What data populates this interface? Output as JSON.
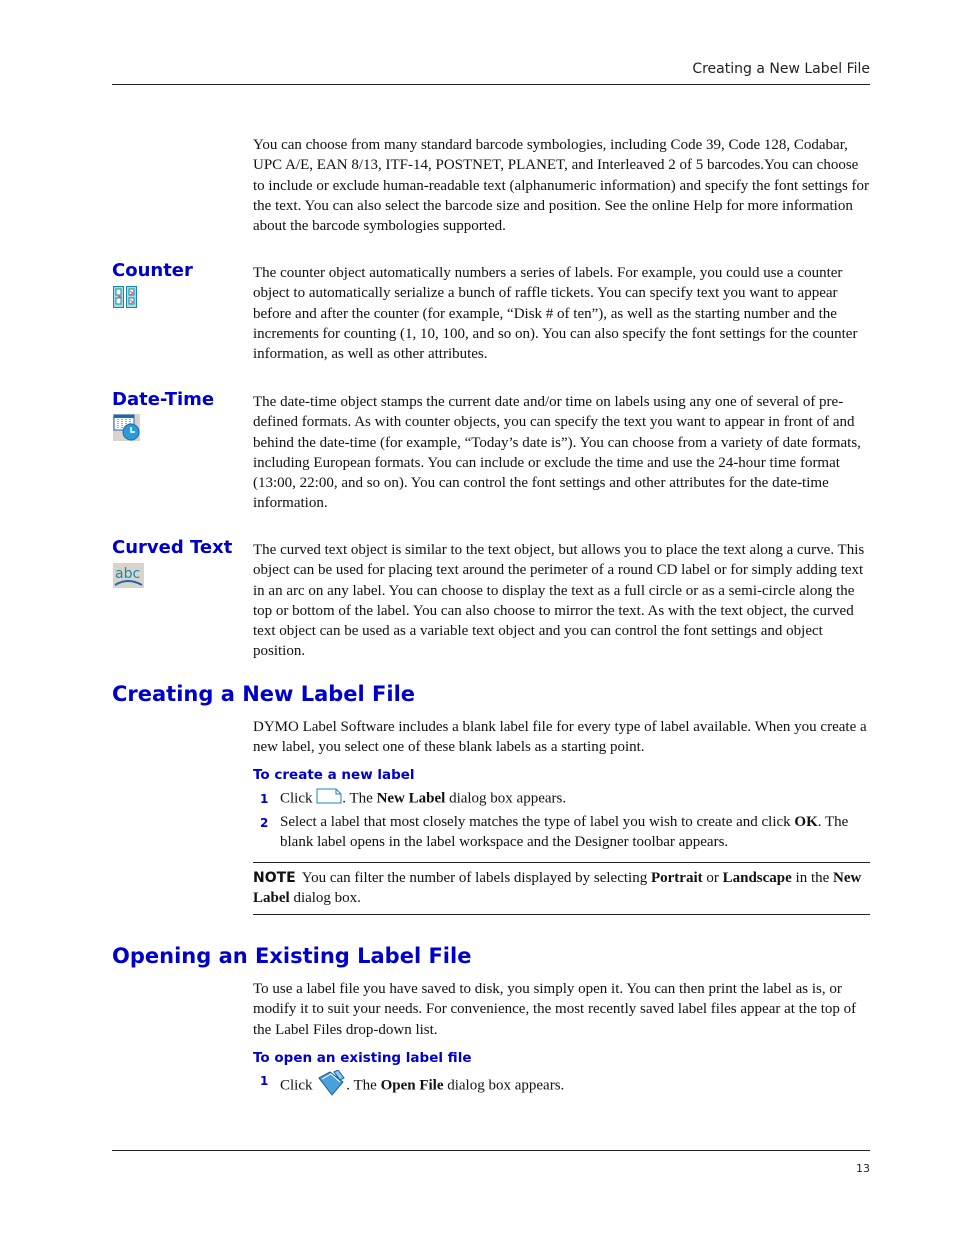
{
  "header": {
    "title": "Creating a New Label File"
  },
  "footer": {
    "page_number": "13"
  },
  "intro_paragraph": "You can choose from many standard barcode symbologies, including Code 39, Code 128, Codabar, UPC A/E, EAN 8/13, ITF-14, POSTNET, PLANET, and Interleaved 2 of 5 barcodes.You can choose to include or exclude human-readable text (alphanumeric information) and specify the font settings for the text. You can also select the barcode size and position. See the online Help for more information about the barcode symbologies supported.",
  "objects": [
    {
      "title": "Counter",
      "icon": "counter-icon",
      "text": "The counter object automatically numbers a series of labels. For example, you could use a counter object to automatically serialize a bunch of raffle tickets. You can specify text you want to appear before and after the counter (for example, “Disk # of ten”), as well as the starting number and the increments for counting (1, 10, 100, and so on). You can also specify the font settings for the counter information, as well as other attributes."
    },
    {
      "title": "Date-Time",
      "icon": "date-time-icon",
      "text": "The date-time object stamps the current date and/or time on labels using any one of several of pre-defined formats. As with counter objects, you can specify the text you want to appear in front of and behind the date-time (for example, “Today’s date is”). You can choose from a variety of date formats, including European formats. You can include or exclude the time and use the 24-hour time format (13:00, 22:00, and so on). You can control the font settings and other attributes for the date-time information."
    },
    {
      "title": "Curved Text",
      "icon": "curved-text-icon",
      "text": "The curved text object is similar to the text object, but allows you to place the text along a curve. This object can be used for placing text around the perimeter of a round CD label or for simply adding text in an arc on any label. You can choose to display the text as a full circle or as a semi-circle along the top or bottom of the label. You can also choose to mirror the text. As with the text object, the curved text object can be used as a variable text object and you can control the font settings and object position."
    }
  ],
  "section_new": {
    "title": "Creating a New Label File",
    "text": "DYMO Label Software includes a blank label file for every type of label available. When you create a new label, you select one of these blank labels as a starting point.",
    "procedure_title": "To create a new label",
    "steps": [
      {
        "num": "1",
        "pre": "Click",
        "icon": "new-label-icon",
        "post_a": ". The ",
        "bold_a": "New Label",
        "post_b": " dialog box appears."
      },
      {
        "num": "2",
        "pre": "Select a label that most closely matches the type of label you wish to create and click ",
        "bold_a": "OK",
        "post_b": ". The blank label opens in the label workspace and the Designer toolbar appears."
      }
    ],
    "note": {
      "label": "NOTE",
      "t1": "You can filter the number of labels displayed by selecting ",
      "b1": "Portrait",
      "t2": " or ",
      "b2": "Landscape",
      "t3": " in the ",
      "b3": "New Label",
      "t4": " dialog box."
    }
  },
  "section_open": {
    "title": "Opening an Existing Label File",
    "text": "To use a label file you have saved to disk, you simply open it. You can then print the label as is, or modify it to suit your needs. For convenience, the most recently saved label files appear at the top of the Label Files drop-down list.",
    "procedure_title": "To open an existing label file",
    "steps": [
      {
        "num": "1",
        "pre": "Click",
        "icon": "open-file-icon",
        "post_a": ". The ",
        "bold_a": "Open File",
        "post_b": " dialog box appears."
      }
    ]
  }
}
